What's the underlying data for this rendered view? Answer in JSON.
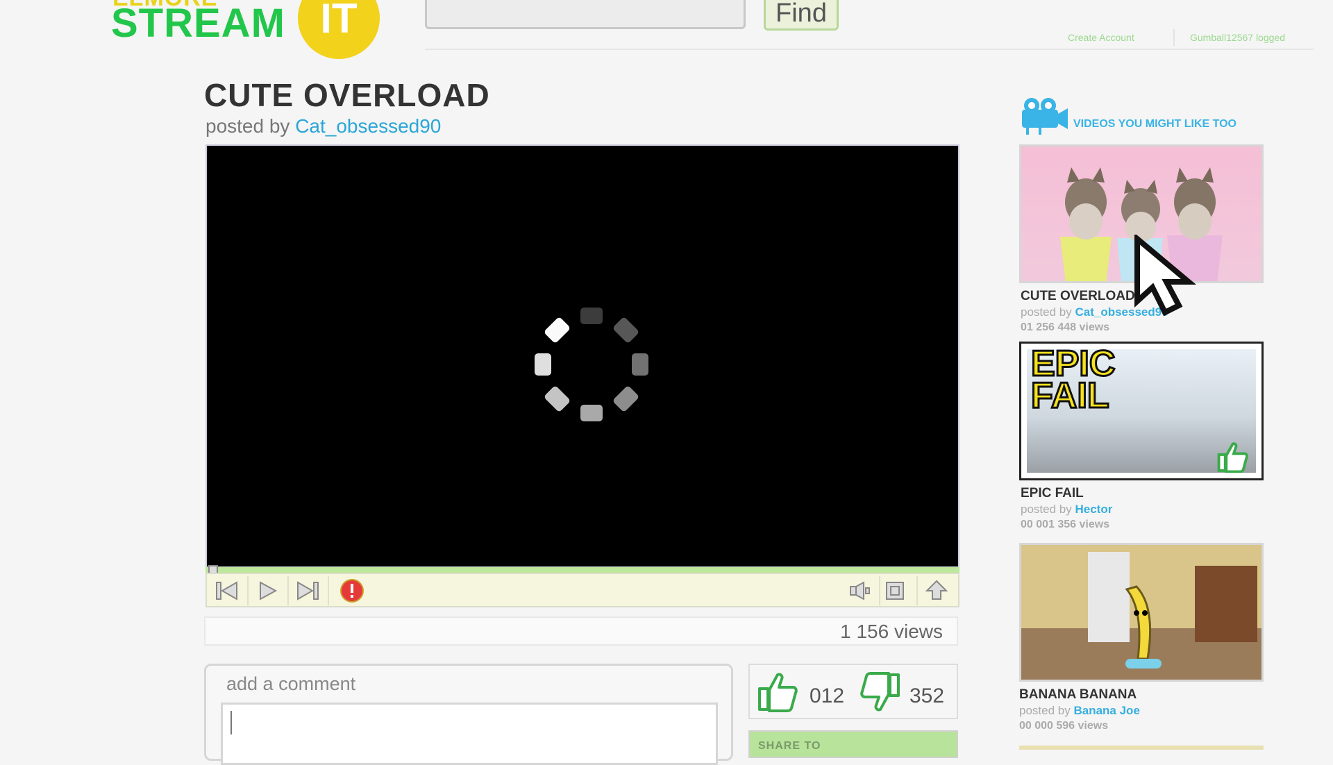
{
  "header": {
    "logo_top": "ELMORE",
    "logo_text": "STREAM",
    "logo_badge": "IT",
    "search_value": "",
    "find_label": "Find",
    "create_account": "Create Account",
    "logged_user": "Gumball12567 logged"
  },
  "video": {
    "title": "CUTE OVERLOAD",
    "posted_by_label": "posted by",
    "author": "Cat_obsessed90",
    "views": "1 156 views",
    "likes": "012",
    "dislikes": "352",
    "share_label": "SHARE TO"
  },
  "comment": {
    "label": "add a comment",
    "value": ""
  },
  "controls": {
    "icons": [
      "skip-back-icon",
      "play-icon",
      "skip-forward-icon",
      "alert-icon",
      "volume-icon",
      "fullscreen-icon",
      "share-upload-icon"
    ]
  },
  "sidebar": {
    "header": "VIDEOS YOU MIGHT LIKE TOO",
    "items": [
      {
        "title": "CUTE OVERLOAD",
        "posted_by_label": "posted by",
        "author": "Cat_obsessed90",
        "views": "01 256 448 views"
      },
      {
        "title": "EPIC FAIL",
        "posted_by_label": "posted by",
        "author": "Hector",
        "views": "00 001 356 views",
        "thumb_text_1": "EPIC",
        "thumb_text_2": "FAIL"
      },
      {
        "title": "BANANA BANANA",
        "posted_by_label": "posted by",
        "author": "Banana Joe",
        "views": "00 000 596 views"
      }
    ]
  },
  "colors": {
    "accent_green": "#22c64a",
    "accent_yellow": "#f2d21b",
    "link_blue": "#2aa5d8",
    "progress_green": "#bde79b"
  }
}
